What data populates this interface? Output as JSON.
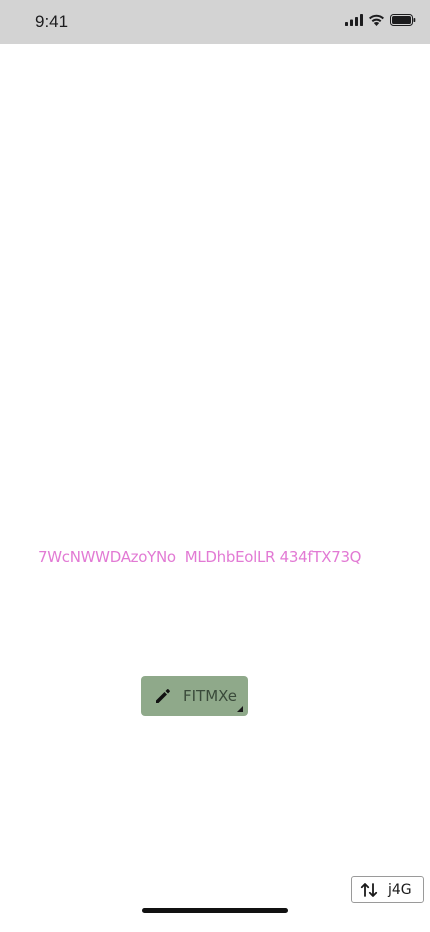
{
  "status_bar": {
    "time": "9:41",
    "icons": [
      "signal-icon",
      "wifi-icon",
      "battery-icon"
    ]
  },
  "content": {
    "text": "7WcNWWDAzoYNo  MLDhbEolLR 434fTX73Q",
    "text_color": "#e27ad4"
  },
  "edit_button": {
    "label": "FITMXe",
    "icon": "pencil-icon",
    "background": "#8fa98a"
  },
  "sort_button": {
    "label": "j4G",
    "icon": "sort-arrows-icon"
  }
}
